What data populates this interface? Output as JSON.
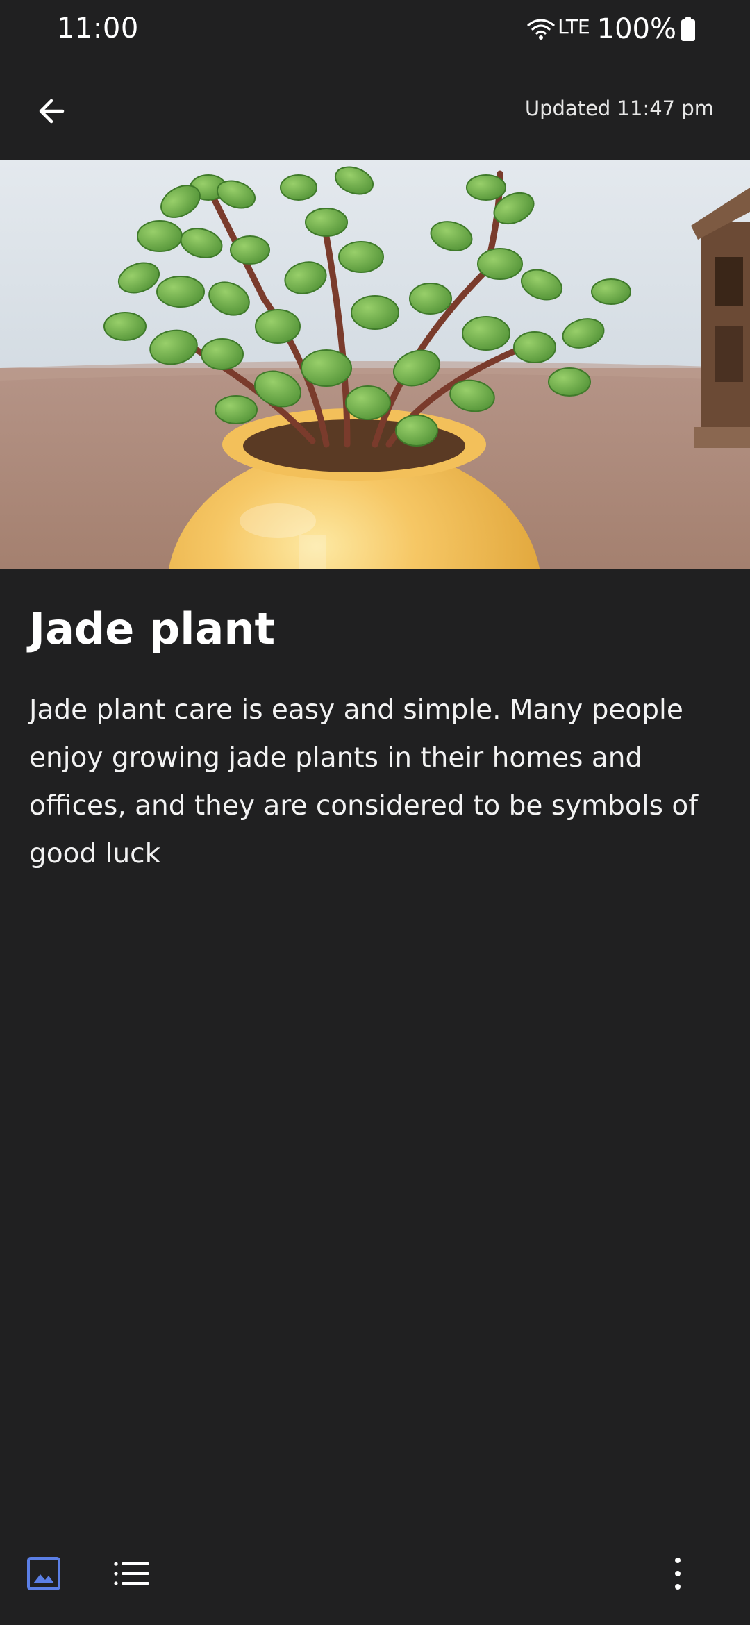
{
  "status_bar": {
    "time": "11:00",
    "network": "LTE",
    "battery": "100%",
    "icons": [
      "wifi-icon",
      "battery-icon"
    ]
  },
  "app_bar": {
    "back_icon": "arrow-left-icon",
    "updated_text": "Updated 11:47 pm"
  },
  "note": {
    "image_subject": "jade plant in yellow pot",
    "title": "Jade plant",
    "body": "Jade plant care is easy and simple. Many people enjoy growing jade plants in their homes and offices, and they are considered to be symbols of good luck"
  },
  "toolbar": {
    "icons": [
      "image-icon",
      "checklist-icon",
      "more-vertical-icon"
    ],
    "accent_color": "#5b7fe6"
  },
  "colors": {
    "background": "#202021",
    "text": "#ffffff"
  }
}
